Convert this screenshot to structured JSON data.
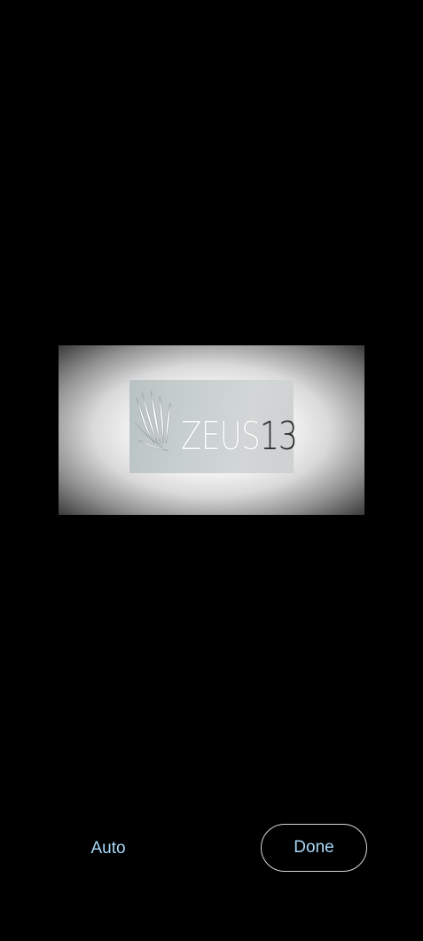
{
  "preview": {
    "logo_brand": "ZEUS",
    "logo_number": "13"
  },
  "actions": {
    "auto_label": "Auto",
    "done_label": "Done"
  },
  "colors": {
    "background": "#000000",
    "accent_text": "#a8d8f8",
    "button_border": "#d8d8d8"
  }
}
